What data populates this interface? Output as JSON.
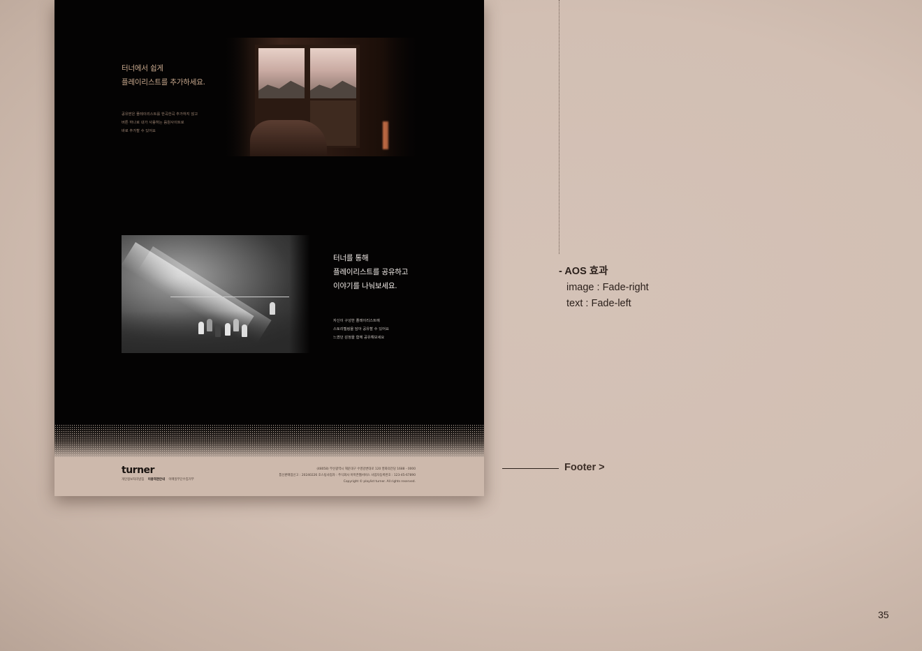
{
  "section1": {
    "title_lines": [
      "터너에서 쉽게",
      "플레이리스트를 추가하세요."
    ],
    "desc_lines": [
      "공유받은 플레이리스트를 한곡한곡 추가하지 않고",
      "버튼 하나로 내가 사용하는 음원사이트로",
      "바로 추가할 수 있어요"
    ],
    "image_icon": "room-window-photo"
  },
  "section2": {
    "title_lines": [
      "터너를 통해",
      "플레이리스트를 공유하고",
      "이야기를 나눠보세요."
    ],
    "desc_lines": [
      "자신이 구성한 플레이리스트에",
      "스토리텔링을 담아 공유할 수 있어요",
      "느꼈던 감정을 함께 공유해보세요"
    ],
    "image_icon": "gym-group-photo"
  },
  "footer": {
    "logo": "turner",
    "links": [
      "개인정보처리방침",
      "이용약관안내",
      "이메일무단수집거부"
    ],
    "info_lines": [
      "(48058) 부산광역시 해운대구 수영강변대로 120 영화의전당 1688 - 0000",
      "통신판매업신고 : 20240226 호스팅사업자 : 주식회사 아마존웹서비스 사업자등록번호 : 123-45-67890",
      "Copyright © playlist turner. All rights reserved."
    ]
  },
  "annotation": {
    "aos_title": "- AOS 효과",
    "aos_image": "image : Fade-right",
    "aos_text": "text : Fade-left",
    "footer_label": "Footer >"
  },
  "page_number": "35",
  "colors": {
    "background": "#d2bfb3",
    "mockup_bg": "#040303",
    "accent_text": "#c9a98e",
    "footer_bg": "#cdb9ac"
  }
}
